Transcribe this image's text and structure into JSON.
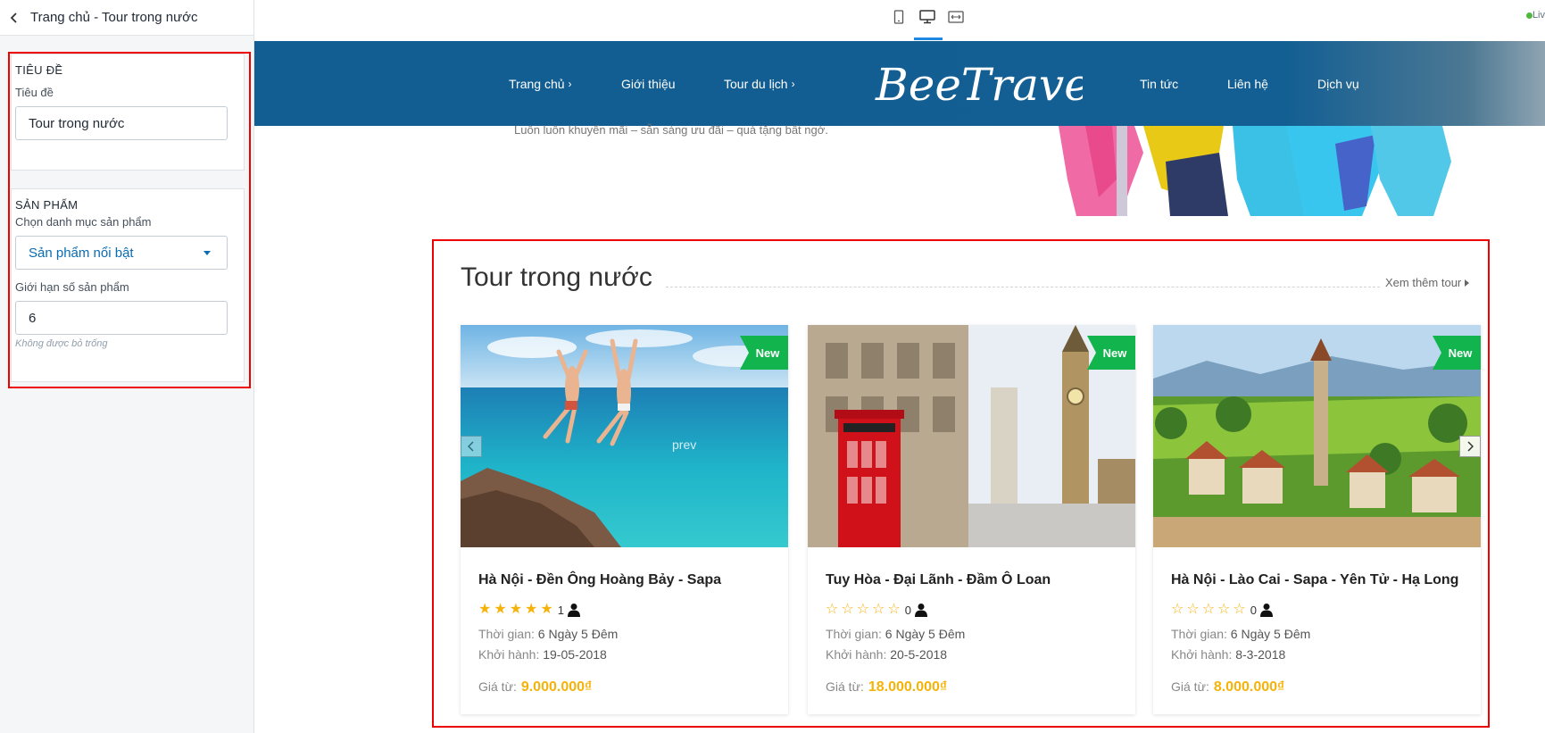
{
  "sidebar": {
    "title": "Trang chủ - Tour trong nước",
    "section_title": {
      "heading": "TIÊU ĐỀ",
      "field_label": "Tiêu đề",
      "field_value": "Tour trong nước"
    },
    "section_products": {
      "heading": "SẢN PHẨM",
      "category_label": "Chọn danh mục sản phẩm",
      "category_value": "Sản phẩm nổi bật",
      "limit_label": "Giới hạn số sản phẩm",
      "limit_value": "6",
      "limit_hint": "Không được bỏ trống"
    }
  },
  "toolbar": {
    "live_text": "Liv",
    "icons": [
      "mobile-icon",
      "desktop-icon",
      "fullwidth-icon"
    ]
  },
  "site": {
    "nav_left": [
      {
        "label": "Trang chủ",
        "has_caret": true
      },
      {
        "label": "Giới thiệu",
        "has_caret": false
      },
      {
        "label": "Tour du lịch",
        "has_caret": true
      }
    ],
    "logo_text": "BeeTravel",
    "nav_right": [
      {
        "label": "Tin tức"
      },
      {
        "label": "Liên hệ"
      },
      {
        "label": "Dịch vụ"
      }
    ],
    "header_color": "#125e93",
    "promo_line": "Luôn luôn khuyến mãi – sẵn sàng ưu đãi – quà tặng bất ngờ."
  },
  "tour_section": {
    "title": "Tour trong nước",
    "see_more": "Xem thêm tour",
    "prev_text": "prev",
    "badge_label": "New",
    "time_label": "Thời gian:",
    "depart_label": "Khởi hành:",
    "price_label": "Giá từ:",
    "accent_color": "#f5b30a",
    "badge_color": "#12b54d",
    "cards": [
      {
        "name": "Hà Nội - Đền Ông Hoàng Bảy - Sapa",
        "stars": 5,
        "rating_count": "1",
        "duration": "6 Ngày 5 Đêm",
        "departure": "19-05-2018",
        "price": "9.000.000₫"
      },
      {
        "name": "Tuy Hòa - Đại Lãnh - Đầm Ô Loan",
        "stars": 0,
        "rating_count": "0",
        "duration": "6 Ngày 5 Đêm",
        "departure": "20-5-2018",
        "price": "18.000.000₫"
      },
      {
        "name": "Hà Nội - Lào Cai - Sapa - Yên Tử - Hạ Long",
        "stars": 0,
        "rating_count": "0",
        "duration": "6 Ngày 5 Đêm",
        "departure": "8-3-2018",
        "price": "8.000.000₫"
      }
    ]
  }
}
